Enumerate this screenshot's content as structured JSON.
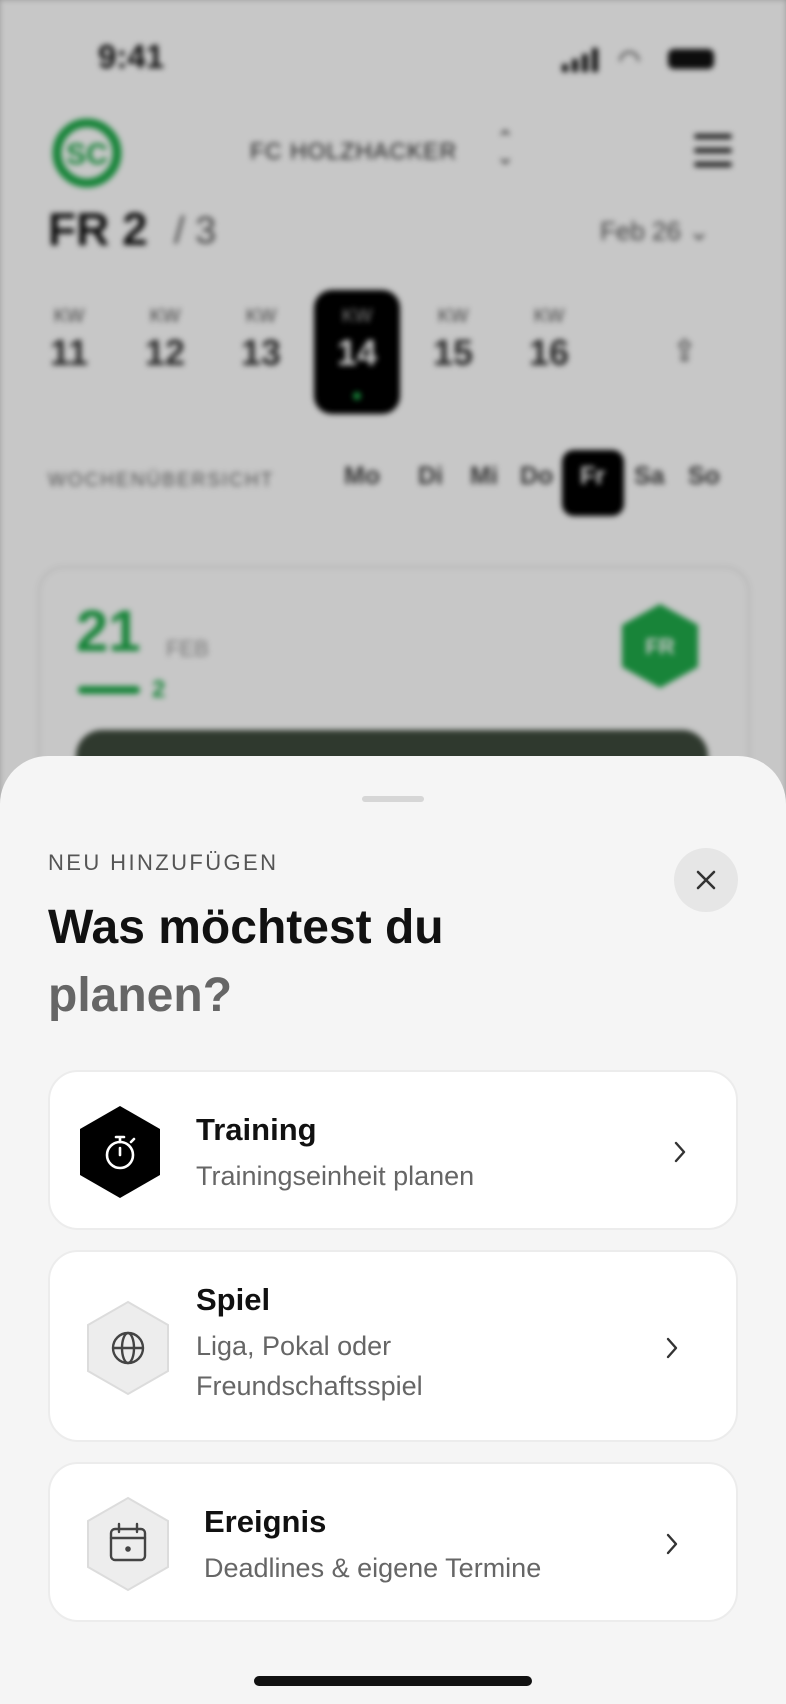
{
  "status_bar": {
    "time": "9:41"
  },
  "header": {
    "club_name": "FC HOLZHACKER",
    "logo_text": "SC",
    "fr_label": "FR 2",
    "fr_total": "/ 3",
    "month": "Feb 26"
  },
  "weeks": [
    {
      "kw": "KW",
      "num": "11"
    },
    {
      "kw": "KW",
      "num": "12"
    },
    {
      "kw": "KW",
      "num": "13"
    },
    {
      "kw": "KW",
      "num": "14"
    },
    {
      "kw": "KW",
      "num": "15"
    },
    {
      "kw": "KW",
      "num": "16"
    }
  ],
  "overview": {
    "label": "WOCHENÜBERSICHT",
    "days": [
      "Mo",
      "Di",
      "Mi",
      "Do",
      "Fr",
      "Sa",
      "So"
    ]
  },
  "event_card": {
    "date_num": "21",
    "date_month": "FEB",
    "count": "2",
    "badge": "FR"
  },
  "sheet": {
    "overline": "NEU HINZUFÜGEN",
    "heading_line1": "Was möchtest du",
    "heading_line2": "planen?",
    "options": [
      {
        "title": "Training",
        "subtitle": "Trainingseinheit planen",
        "icon": "stopwatch-icon"
      },
      {
        "title": "Spiel",
        "subtitle_line1": "Liga, Pokal oder",
        "subtitle_line2": "Freundschaftsspiel",
        "icon": "globe-icon"
      },
      {
        "title": "Ereignis",
        "subtitle": "Deadlines & eigene Termine",
        "icon": "calendar-icon"
      }
    ]
  },
  "colors": {
    "accent_green": "#1faa4a",
    "sheet_bg": "#f5f5f5",
    "card_bg": "#ffffff",
    "text_primary": "#111111",
    "text_secondary": "#666666"
  }
}
